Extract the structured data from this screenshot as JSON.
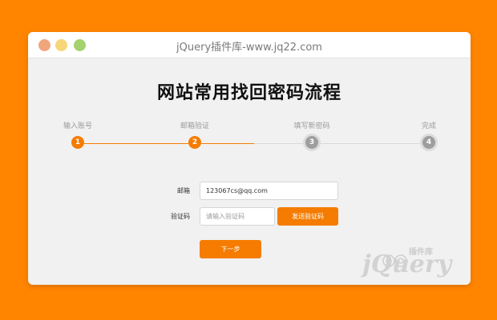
{
  "window": {
    "title": "jQuery插件库-www.jq22.com"
  },
  "page": {
    "heading": "网站常用找回密码流程"
  },
  "steps": [
    {
      "number": "1",
      "label": "输入账号",
      "state": "active"
    },
    {
      "number": "2",
      "label": "邮箱验证",
      "state": "active"
    },
    {
      "number": "3",
      "label": "填写新密码",
      "state": "inactive"
    },
    {
      "number": "4",
      "label": "完成",
      "state": "inactive"
    }
  ],
  "form": {
    "email_label": "邮箱",
    "email_value": "123067cs@qq.com",
    "code_label": "验证码",
    "code_placeholder": "请输入验证码",
    "send_code_button": "发送验证码",
    "next_button": "下一步"
  },
  "watermark": {
    "text": "jQuery",
    "subtext": "插件库"
  },
  "colors": {
    "background": "#ff8400",
    "accent": "#f57c00",
    "inactive_step": "#9e9e9e"
  }
}
